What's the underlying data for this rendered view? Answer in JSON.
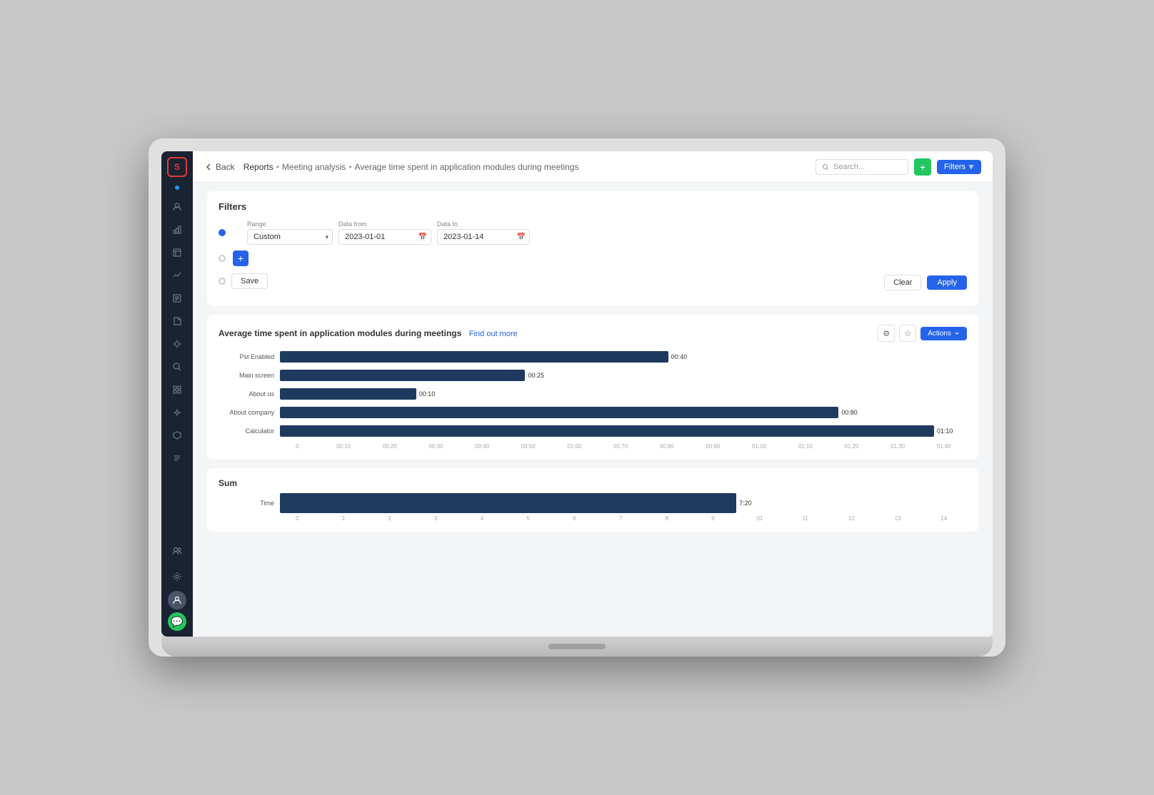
{
  "app": {
    "logo_text": "S"
  },
  "header": {
    "back_label": "Back",
    "breadcrumb": {
      "part1": "Reports",
      "sep1": "•",
      "part2": "Meeting analysis",
      "sep2": "•",
      "part3": "Average time spent in application modules during meetings"
    },
    "search_placeholder": "Search...",
    "btn_plus": "+",
    "btn_filters": "Filters"
  },
  "filters": {
    "title": "Filters",
    "range_label": "Range",
    "range_value": "Custom",
    "date_from_label": "Data from",
    "date_from_value": "2023-01-01",
    "date_to_label": "Data to",
    "date_to_value": "2023-01-14",
    "btn_save": "Save",
    "btn_clear": "Clear",
    "btn_apply": "Apply"
  },
  "main_chart": {
    "title": "Average time spent in application modules during meetings",
    "link_text": "Find out more",
    "btn_actions": "Actions",
    "bars": [
      {
        "label": "Pst Enabled",
        "value": "00:40",
        "width_pct": 57
      },
      {
        "label": "Main screen",
        "value": "00:25",
        "width_pct": 36
      },
      {
        "label": "About us",
        "value": "00:10",
        "width_pct": 20
      },
      {
        "label": "About company",
        "value": "00:80",
        "width_pct": 82
      },
      {
        "label": "Calculator",
        "value": "01:10",
        "width_pct": 96
      }
    ],
    "x_axis_ticks": [
      "0",
      "00:10",
      "00:20",
      "00:30",
      "00:40",
      "00:50",
      "01:00",
      "00:70",
      "00:80",
      "00:90",
      "01:00",
      "01:10",
      "01:20",
      "01:30",
      "01:40"
    ]
  },
  "sum_chart": {
    "title": "Sum",
    "bars": [
      {
        "label": "Time",
        "value": "7:20",
        "width_pct": 67
      }
    ],
    "x_axis_ticks": [
      "0",
      "1",
      "2",
      "3",
      "4",
      "5",
      "6",
      "7",
      "8",
      "9",
      "10",
      "11",
      "12",
      "13",
      "14"
    ]
  },
  "sidebar_icons": [
    "👤",
    "📊",
    "📁",
    "🔄",
    "📋",
    "📝",
    "⚙️",
    "🔍",
    "📦",
    "🔗",
    "📐",
    "🗂️",
    "📌",
    "🔔",
    "📅"
  ]
}
